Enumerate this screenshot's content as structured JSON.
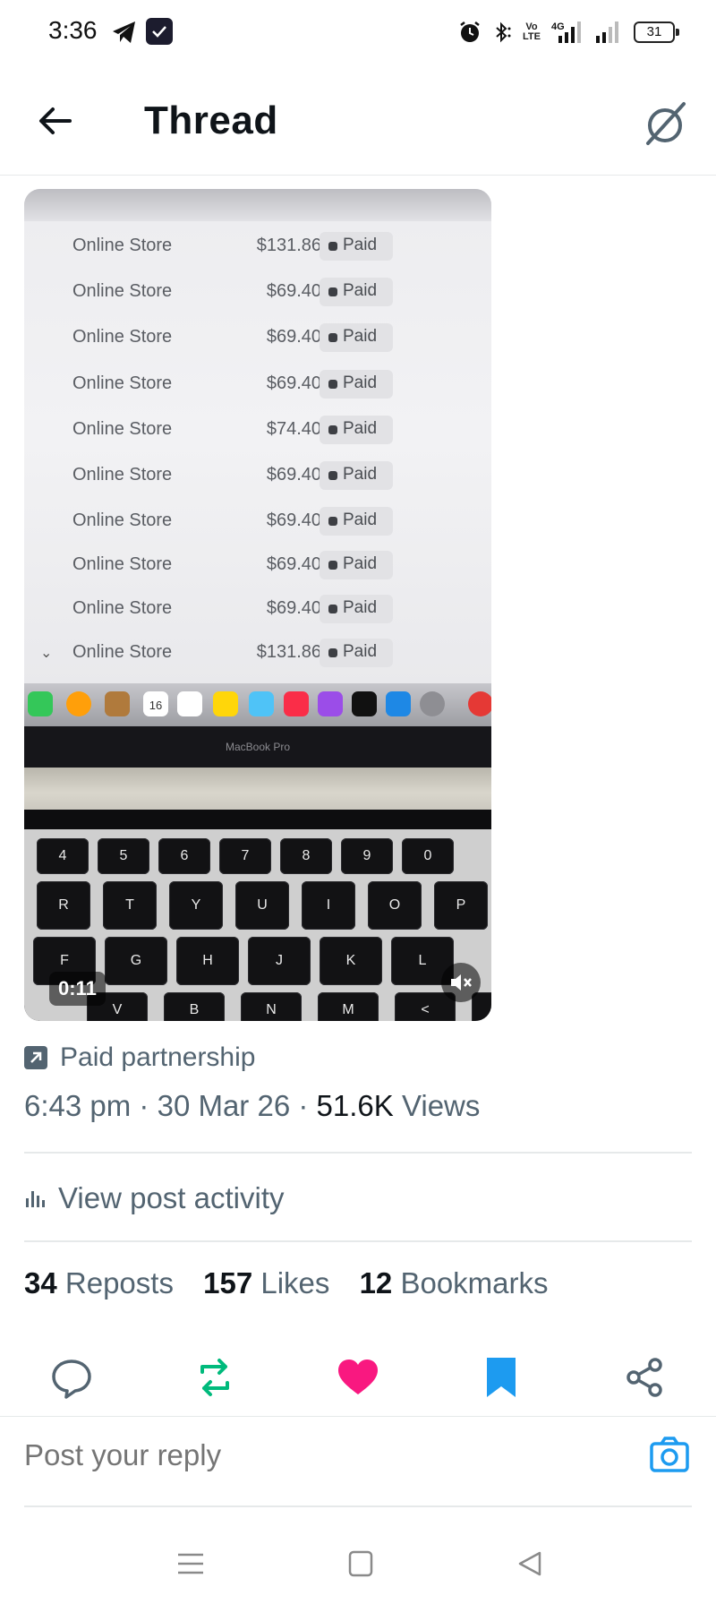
{
  "status_bar": {
    "time": "3:36",
    "battery": "31",
    "icons": [
      "telegram-icon",
      "app-badge-icon",
      "alarm-icon",
      "bluetooth-icon",
      "volte-icon",
      "4g-signal-icon",
      "signal-icon",
      "battery-icon"
    ],
    "volte_label_top": "Vo",
    "volte_label_bottom": "LTE",
    "network": "4G"
  },
  "header": {
    "title": "Thread",
    "back_icon": "arrow-left-icon",
    "right_icon": "grok-icon"
  },
  "media": {
    "duration": "0:11",
    "mute_icon": "volume-muted-icon",
    "laptop_label": "MacBook Pro",
    "orders": [
      {
        "store": "Online Store",
        "amount": "$131.86",
        "status": "Paid"
      },
      {
        "store": "Online Store",
        "amount": "$69.40",
        "status": "Paid"
      },
      {
        "store": "Online Store",
        "amount": "$69.40",
        "status": "Paid"
      },
      {
        "store": "Online Store",
        "amount": "$69.40",
        "status": "Paid"
      },
      {
        "store": "Online Store",
        "amount": "$74.40",
        "status": "Paid"
      },
      {
        "store": "Online Store",
        "amount": "$69.40",
        "status": "Paid"
      },
      {
        "store": "Online Store",
        "amount": "$69.40",
        "status": "Paid"
      },
      {
        "store": "Online Store",
        "amount": "$69.40",
        "status": "Paid"
      },
      {
        "store": "Online Store",
        "amount": "$69.40",
        "status": "Paid"
      },
      {
        "store": "Online Store",
        "amount": "$131.86",
        "status": "Paid"
      }
    ],
    "calendar_day": "16",
    "keyboard": {
      "number_row": [
        "4",
        "5",
        "6",
        "7",
        "8",
        "9",
        "0"
      ],
      "top_row": [
        "R",
        "T",
        "Y",
        "U",
        "I",
        "O",
        "P"
      ],
      "home_row": [
        "F",
        "G",
        "H",
        "J",
        "K",
        "L"
      ],
      "bottom_row": [
        "V",
        "B",
        "N",
        "M",
        "<",
        ">"
      ]
    }
  },
  "post": {
    "partnership_label": "Paid partnership",
    "time": "6:43 pm",
    "separator": "·",
    "date": "30 Mar 26",
    "views_count": "51.6K",
    "views_label": "Views",
    "activity_label": "View post activity",
    "reposts_count": "34",
    "reposts_label": "Reposts",
    "likes_count": "157",
    "likes_label": "Likes",
    "bookmarks_count": "12",
    "bookmarks_label": "Bookmarks"
  },
  "actions": {
    "reply_icon": "reply-icon",
    "repost_icon": "repost-icon",
    "like_icon": "heart-icon",
    "bookmark_icon": "bookmark-icon",
    "share_icon": "share-icon",
    "colors": {
      "repost": "#00ba7c",
      "like": "#f91880",
      "bookmark": "#1d9bf0",
      "default": "#536471"
    }
  },
  "reply": {
    "placeholder": "Post your reply",
    "camera_icon": "camera-icon"
  },
  "nav": {
    "menu_icon": "menu-icon",
    "home_icon": "home-square-icon",
    "back_icon": "back-triangle-icon"
  }
}
